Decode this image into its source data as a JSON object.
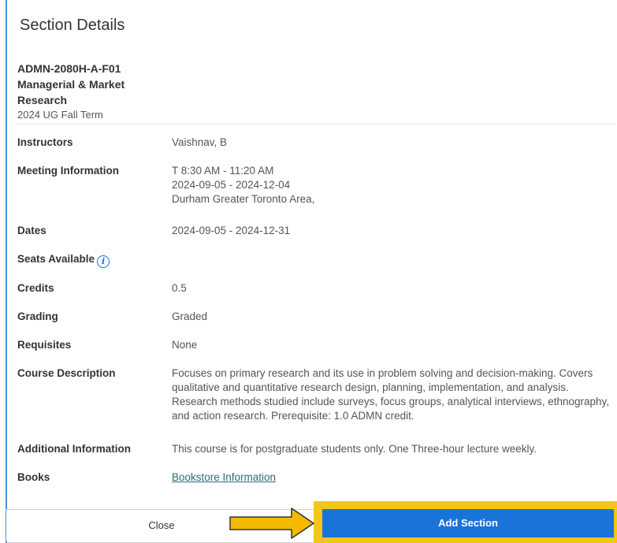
{
  "dialog": {
    "title": "Section Details"
  },
  "course": {
    "code": "ADMN-2080H-A-F01",
    "name_line1": "Managerial & Market",
    "name_line2": "Research",
    "term": "2024 UG Fall Term"
  },
  "details": {
    "instructors_label": "Instructors",
    "instructors_value": "Vaishnav, B",
    "meeting_label": "Meeting Information",
    "meeting_time": "T 8:30 AM - 11:20 AM",
    "meeting_dates": "2024-09-05 - 2024-12-04",
    "meeting_location": "Durham Greater Toronto Area,",
    "dates_label": "Dates",
    "dates_value": "2024-09-05 - 2024-12-31",
    "seats_label": "Seats Available",
    "seats_info_icon": "i",
    "credits_label": "Credits",
    "credits_value": "0.5",
    "grading_label": "Grading",
    "grading_value": "Graded",
    "requisites_label": "Requisites",
    "requisites_value": "None",
    "description_label": "Course Description",
    "description_value": "Focuses on primary research and its use in problem solving and decision-making. Covers qualitative and quantitative research design, planning, implementation, and analysis. Research methods studied include surveys, focus groups, analytical interviews, ethnography, and action research. Prerequisite: 1.0 ADMN credit.",
    "additional_label": "Additional Information",
    "additional_value": "This course is for postgraduate students only. One Three-hour lecture weekly.",
    "books_label": "Books",
    "books_link": "Bookstore Information"
  },
  "footer": {
    "close_label": "Close",
    "add_section_label": "Add Section"
  },
  "colors": {
    "accent": "#1a73d9",
    "highlight": "#f5c518",
    "arrow": "#f5b800"
  }
}
